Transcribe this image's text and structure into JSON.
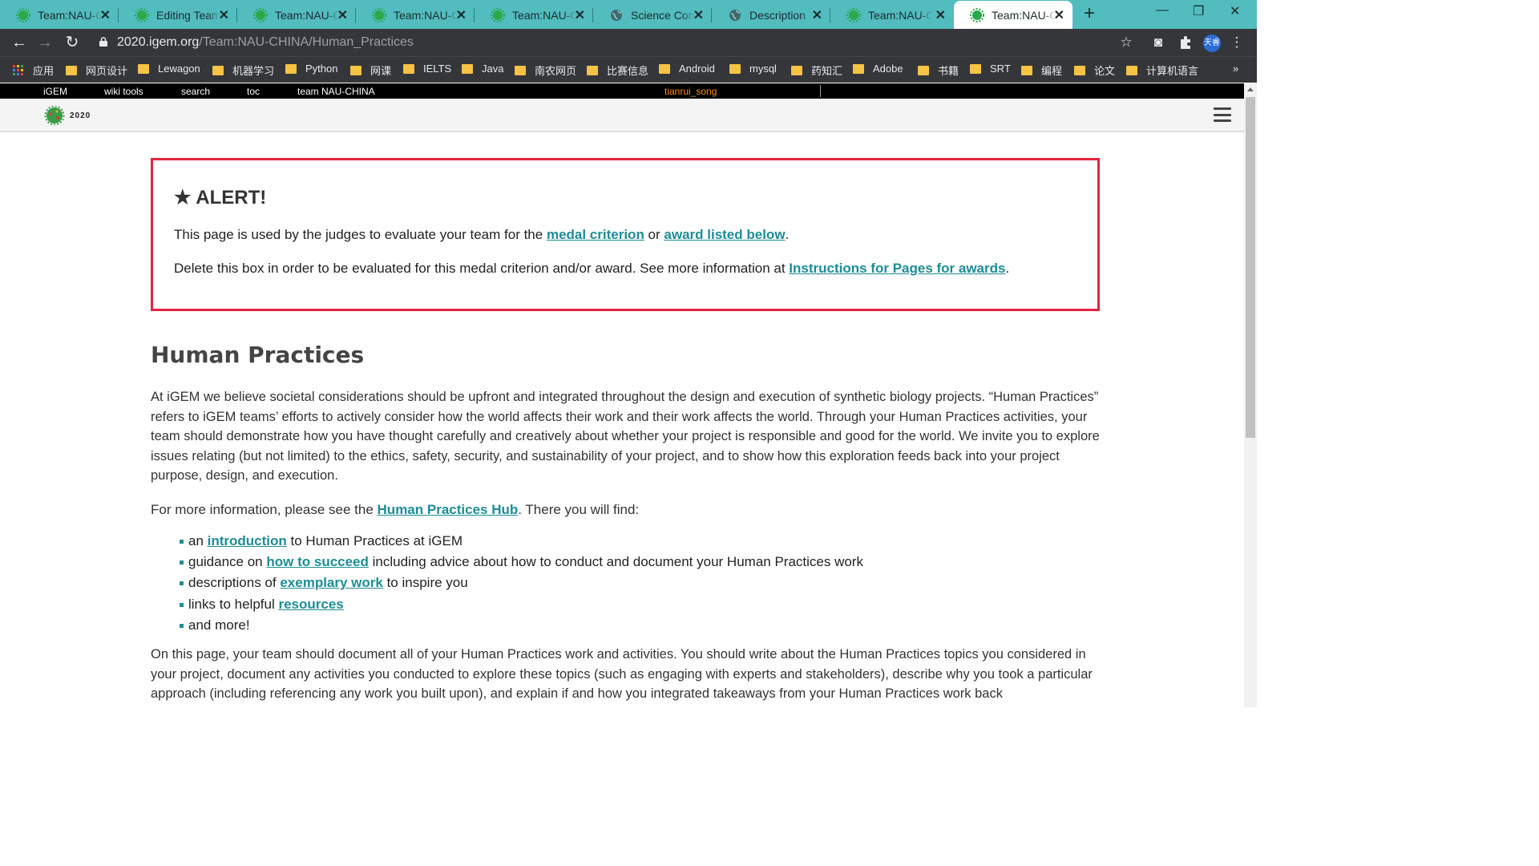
{
  "browser": {
    "tabs": [
      {
        "title": "Team:NAU-CHINA",
        "icon": "igem-favicon"
      },
      {
        "title": "Editing Team:NAU-CHINA",
        "icon": "igem-favicon"
      },
      {
        "title": "Team:NAU-CHINA",
        "icon": "igem-favicon"
      },
      {
        "title": "Team:NAU-CHINA",
        "icon": "igem-favicon"
      },
      {
        "title": "Team:NAU-CHINA",
        "icon": "igem-favicon"
      },
      {
        "title": "Science Communication",
        "icon": "globe-icon"
      },
      {
        "title": "Description",
        "icon": "globe-icon"
      },
      {
        "title": "Team:NAU-CHINA",
        "icon": "igem-favicon"
      },
      {
        "title": "Team:NAU-CHINA",
        "icon": "igem-favicon",
        "active": true
      }
    ],
    "close_glyph": "✕",
    "new_tab_glyph": "+",
    "window_buttons": {
      "minimize": "—",
      "restore": "❐",
      "close": "✕"
    },
    "url": {
      "host": "2020.igem.org",
      "path": "/Team:NAU-CHINA/Human_Practices"
    },
    "profile_label": "天睿",
    "bookmarks": [
      "应用",
      "网页设计",
      "Lewagon",
      "机器学习",
      "Python",
      "网课",
      "IELTS",
      "Java",
      "南农网页",
      "比赛信息",
      "Android",
      "mysql",
      "药知汇",
      "Adobe",
      "书籍",
      "SRT",
      "编程",
      "论文",
      "计算机语言"
    ],
    "bookmarks_overflow": "»"
  },
  "igem_bar": {
    "items": [
      "iGEM",
      "wiki tools",
      "search",
      "toc",
      "team NAU-CHINA"
    ],
    "user": "tianrui_song"
  },
  "header": {
    "logo_text": "iGEM",
    "year": "2020"
  },
  "alert": {
    "title": "★ ALERT!",
    "line1_before": "This page is used by the judges to evaluate your team for the ",
    "line1_link1": "medal criterion",
    "line1_mid": " or ",
    "line1_link2": "award listed below",
    "line1_after": ".",
    "line2_before": "Delete this box in order to be evaluated for this medal criterion and/or award. See more information at ",
    "line2_link": "Instructions for Pages for awards",
    "line2_after": "."
  },
  "main": {
    "title": "Human Practices",
    "intro": "At iGEM we believe societal considerations should be upfront and integrated throughout the design and execution of synthetic biology projects. “Human Practices” refers to iGEM teams’ efforts to actively consider how the world affects their work and their work affects the world. Through your Human Practices activities, your team should demonstrate how you have thought carefully and creatively about whether your project is responsible and good for the world. We invite you to explore issues relating (but not limited) to the ethics, safety, security, and sustainability of your project, and to show how this exploration feeds back into your project purpose, design, and execution.",
    "more_before": "For more information, please see the ",
    "more_link": "Human Practices Hub",
    "more_after": ". There you will find:",
    "list": [
      {
        "before": "an ",
        "link": "introduction",
        "after": " to Human Practices at iGEM"
      },
      {
        "before": "guidance on ",
        "link": "how to succeed",
        "after": " including advice about how to conduct and document your Human Practices work"
      },
      {
        "before": "descriptions of ",
        "link": "exemplary work",
        "after": " to inspire you"
      },
      {
        "before": "links to helpful ",
        "link": "resources",
        "after": ""
      },
      {
        "before": "and more!",
        "link": "",
        "after": ""
      }
    ],
    "closing": "On this page, your team should document all of your Human Practices work and activities. You should write about the Human Practices topics you considered in your project, document any activities you conducted to explore these topics (such as engaging with experts and stakeholders), describe why you took a particular approach (including referencing any work you built upon), and explain if and how you integrated takeaways from your Human Practices work back"
  },
  "colors": {
    "tab_strip": "#52bcbf",
    "toolbar": "#35363a",
    "link": "#1c8d96",
    "alert_border": "#e2253f",
    "bookmark_folder": "#f6c344",
    "username": "#ff8c00"
  }
}
